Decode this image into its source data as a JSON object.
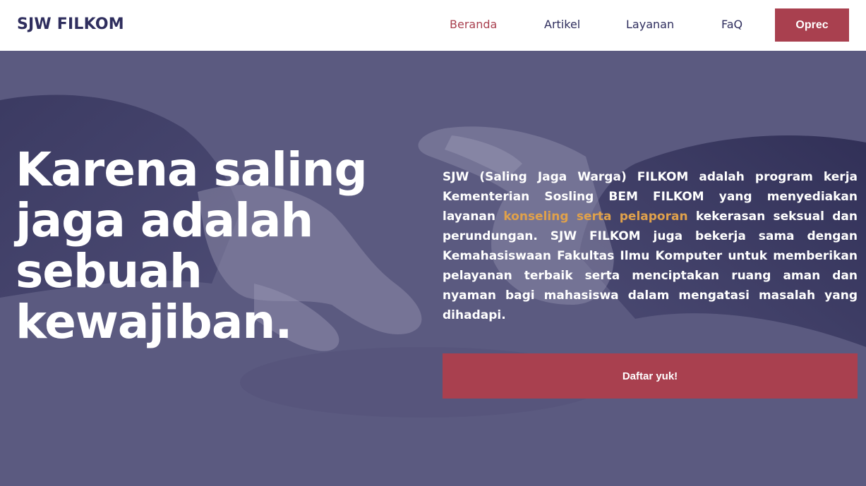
{
  "navbar": {
    "brand": "SJW FILKOM",
    "links": [
      {
        "label": "Beranda",
        "active": true
      },
      {
        "label": "Artikel",
        "active": false
      },
      {
        "label": "Layanan",
        "active": false
      },
      {
        "label": "FaQ",
        "active": false
      }
    ],
    "cta_label": "Oprec"
  },
  "hero": {
    "heading_lines": [
      "Karena saling",
      "jaga adalah",
      "sebuah",
      "kewajiban."
    ],
    "description": {
      "part1": "SJW (Saling Jaga Warga) FILKOM adalah program kerja Kementerian Sosling BEM FILKOM yang menyediakan layanan ",
      "highlight": "konseling serta pelaporan",
      "part2": " kekerasan seksual dan perundungan. SJW FILKOM juga bekerja sama dengan Kemahasiswaan Fakultas Ilmu Komputer untuk memberikan pelayanan terbaik serta menciptakan ruang aman dan nyaman bagi mahasiswa dalam mengatasi masalah yang dihadapi."
    },
    "button_label": "Daftar yuk!"
  },
  "colors": {
    "brand_navy": "#2f2e5e",
    "accent_red": "#a9404f",
    "highlight_orange": "#e0a14b",
    "hero_bg": "#5b5a80"
  }
}
